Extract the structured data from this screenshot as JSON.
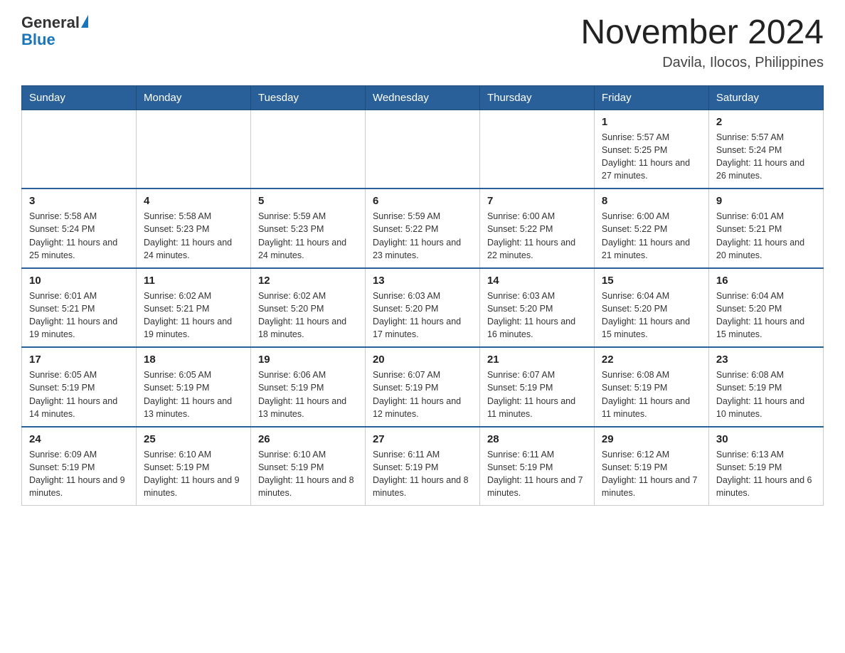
{
  "header": {
    "logo": {
      "general": "General",
      "blue": "Blue"
    },
    "title": "November 2024",
    "subtitle": "Davila, Ilocos, Philippines"
  },
  "weekdays": [
    "Sunday",
    "Monday",
    "Tuesday",
    "Wednesday",
    "Thursday",
    "Friday",
    "Saturday"
  ],
  "weeks": [
    [
      {
        "day": "",
        "info": ""
      },
      {
        "day": "",
        "info": ""
      },
      {
        "day": "",
        "info": ""
      },
      {
        "day": "",
        "info": ""
      },
      {
        "day": "",
        "info": ""
      },
      {
        "day": "1",
        "info": "Sunrise: 5:57 AM\nSunset: 5:25 PM\nDaylight: 11 hours and 27 minutes."
      },
      {
        "day": "2",
        "info": "Sunrise: 5:57 AM\nSunset: 5:24 PM\nDaylight: 11 hours and 26 minutes."
      }
    ],
    [
      {
        "day": "3",
        "info": "Sunrise: 5:58 AM\nSunset: 5:24 PM\nDaylight: 11 hours and 25 minutes."
      },
      {
        "day": "4",
        "info": "Sunrise: 5:58 AM\nSunset: 5:23 PM\nDaylight: 11 hours and 24 minutes."
      },
      {
        "day": "5",
        "info": "Sunrise: 5:59 AM\nSunset: 5:23 PM\nDaylight: 11 hours and 24 minutes."
      },
      {
        "day": "6",
        "info": "Sunrise: 5:59 AM\nSunset: 5:22 PM\nDaylight: 11 hours and 23 minutes."
      },
      {
        "day": "7",
        "info": "Sunrise: 6:00 AM\nSunset: 5:22 PM\nDaylight: 11 hours and 22 minutes."
      },
      {
        "day": "8",
        "info": "Sunrise: 6:00 AM\nSunset: 5:22 PM\nDaylight: 11 hours and 21 minutes."
      },
      {
        "day": "9",
        "info": "Sunrise: 6:01 AM\nSunset: 5:21 PM\nDaylight: 11 hours and 20 minutes."
      }
    ],
    [
      {
        "day": "10",
        "info": "Sunrise: 6:01 AM\nSunset: 5:21 PM\nDaylight: 11 hours and 19 minutes."
      },
      {
        "day": "11",
        "info": "Sunrise: 6:02 AM\nSunset: 5:21 PM\nDaylight: 11 hours and 19 minutes."
      },
      {
        "day": "12",
        "info": "Sunrise: 6:02 AM\nSunset: 5:20 PM\nDaylight: 11 hours and 18 minutes."
      },
      {
        "day": "13",
        "info": "Sunrise: 6:03 AM\nSunset: 5:20 PM\nDaylight: 11 hours and 17 minutes."
      },
      {
        "day": "14",
        "info": "Sunrise: 6:03 AM\nSunset: 5:20 PM\nDaylight: 11 hours and 16 minutes."
      },
      {
        "day": "15",
        "info": "Sunrise: 6:04 AM\nSunset: 5:20 PM\nDaylight: 11 hours and 15 minutes."
      },
      {
        "day": "16",
        "info": "Sunrise: 6:04 AM\nSunset: 5:20 PM\nDaylight: 11 hours and 15 minutes."
      }
    ],
    [
      {
        "day": "17",
        "info": "Sunrise: 6:05 AM\nSunset: 5:19 PM\nDaylight: 11 hours and 14 minutes."
      },
      {
        "day": "18",
        "info": "Sunrise: 6:05 AM\nSunset: 5:19 PM\nDaylight: 11 hours and 13 minutes."
      },
      {
        "day": "19",
        "info": "Sunrise: 6:06 AM\nSunset: 5:19 PM\nDaylight: 11 hours and 13 minutes."
      },
      {
        "day": "20",
        "info": "Sunrise: 6:07 AM\nSunset: 5:19 PM\nDaylight: 11 hours and 12 minutes."
      },
      {
        "day": "21",
        "info": "Sunrise: 6:07 AM\nSunset: 5:19 PM\nDaylight: 11 hours and 11 minutes."
      },
      {
        "day": "22",
        "info": "Sunrise: 6:08 AM\nSunset: 5:19 PM\nDaylight: 11 hours and 11 minutes."
      },
      {
        "day": "23",
        "info": "Sunrise: 6:08 AM\nSunset: 5:19 PM\nDaylight: 11 hours and 10 minutes."
      }
    ],
    [
      {
        "day": "24",
        "info": "Sunrise: 6:09 AM\nSunset: 5:19 PM\nDaylight: 11 hours and 9 minutes."
      },
      {
        "day": "25",
        "info": "Sunrise: 6:10 AM\nSunset: 5:19 PM\nDaylight: 11 hours and 9 minutes."
      },
      {
        "day": "26",
        "info": "Sunrise: 6:10 AM\nSunset: 5:19 PM\nDaylight: 11 hours and 8 minutes."
      },
      {
        "day": "27",
        "info": "Sunrise: 6:11 AM\nSunset: 5:19 PM\nDaylight: 11 hours and 8 minutes."
      },
      {
        "day": "28",
        "info": "Sunrise: 6:11 AM\nSunset: 5:19 PM\nDaylight: 11 hours and 7 minutes."
      },
      {
        "day": "29",
        "info": "Sunrise: 6:12 AM\nSunset: 5:19 PM\nDaylight: 11 hours and 7 minutes."
      },
      {
        "day": "30",
        "info": "Sunrise: 6:13 AM\nSunset: 5:19 PM\nDaylight: 11 hours and 6 minutes."
      }
    ]
  ]
}
